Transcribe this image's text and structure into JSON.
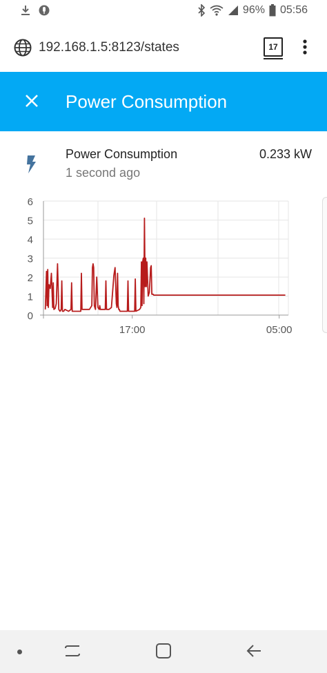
{
  "status_bar": {
    "battery": "96%",
    "time": "05:56",
    "icons": [
      "download-icon",
      "microphone-icon",
      "bluetooth-icon",
      "wifi-icon",
      "signal-icon",
      "battery-icon"
    ]
  },
  "browser": {
    "url": "192.168.1.5:8123/states",
    "tab_count": "17",
    "icons": [
      "globe-icon",
      "tabs-icon",
      "more-vert-icon"
    ]
  },
  "dialog": {
    "title": "Power Consumption",
    "header_color": "#03a9f4",
    "icons": [
      "close-icon"
    ]
  },
  "entity": {
    "name": "Power Consumption",
    "last_changed": "1 second ago",
    "state": "0.233 kW",
    "icon": "flash-icon",
    "icon_color": "#44739e"
  },
  "chart_data": {
    "type": "line",
    "series_color": "#b71c1c",
    "ylim": [
      0,
      6
    ],
    "y_ticks": [
      "0",
      "1",
      "2",
      "3",
      "4",
      "5",
      "6"
    ],
    "x_ticks": [
      "17:00",
      "05:00"
    ],
    "xlim_hours": [
      9.75,
      29.75
    ],
    "grid": true,
    "series": [
      {
        "x": [
          9.9,
          10.0,
          10.05,
          10.1,
          10.15,
          10.2,
          10.3,
          10.4,
          10.5,
          10.55,
          10.6,
          10.7,
          10.8,
          10.9,
          11.0,
          11.1,
          11.2,
          11.25,
          11.3,
          11.4,
          11.5,
          11.8,
          12.0,
          12.05,
          12.1,
          12.5,
          12.8,
          12.85,
          12.9,
          13.2,
          13.5,
          13.7,
          13.75,
          13.8,
          13.85,
          13.9,
          14.0,
          14.1,
          14.2,
          14.3,
          14.35,
          14.4,
          14.8,
          14.85,
          14.9,
          15.0,
          15.1,
          15.3,
          15.5,
          15.6,
          15.7,
          15.75,
          15.8,
          15.85,
          15.9,
          15.95,
          16.0,
          16.5,
          16.6,
          16.65,
          16.7,
          17.0,
          17.2,
          17.25,
          17.3,
          17.6,
          17.7,
          17.75,
          17.8,
          17.85,
          17.9,
          17.95,
          18.0,
          18.05,
          18.1,
          18.15,
          18.2,
          18.3,
          18.4,
          18.5,
          18.55,
          18.6,
          18.7,
          18.75,
          18.8,
          19.0,
          20.0,
          22.0,
          25.0,
          28.0,
          29.5
        ],
        "y": [
          0.3,
          2.3,
          0.5,
          2.4,
          0.4,
          1.6,
          1.4,
          2.2,
          0.4,
          1.7,
          0.3,
          0.35,
          0.6,
          2.7,
          0.3,
          0.2,
          0.3,
          1.8,
          0.2,
          0.2,
          0.3,
          0.2,
          0.3,
          1.7,
          0.2,
          0.2,
          0.2,
          2.2,
          0.3,
          0.3,
          0.3,
          0.5,
          2.5,
          2.7,
          2.5,
          0.5,
          0.3,
          2.0,
          0.4,
          0.3,
          0.5,
          0.3,
          0.3,
          1.8,
          0.3,
          0.3,
          0.3,
          0.4,
          2.1,
          2.5,
          0.6,
          0.4,
          2.2,
          0.5,
          0.3,
          0.3,
          0.2,
          0.2,
          0.2,
          1.8,
          0.2,
          0.2,
          0.2,
          1.9,
          0.2,
          0.3,
          0.4,
          2.8,
          0.5,
          2.8,
          3.0,
          0.6,
          5.1,
          1.5,
          3.0,
          1.5,
          2.8,
          1.0,
          1.2,
          2.5,
          2.6,
          1.1,
          1.1,
          1.05,
          1.05,
          1.05,
          1.05,
          1.05,
          1.05,
          1.05,
          1.05
        ]
      }
    ]
  }
}
